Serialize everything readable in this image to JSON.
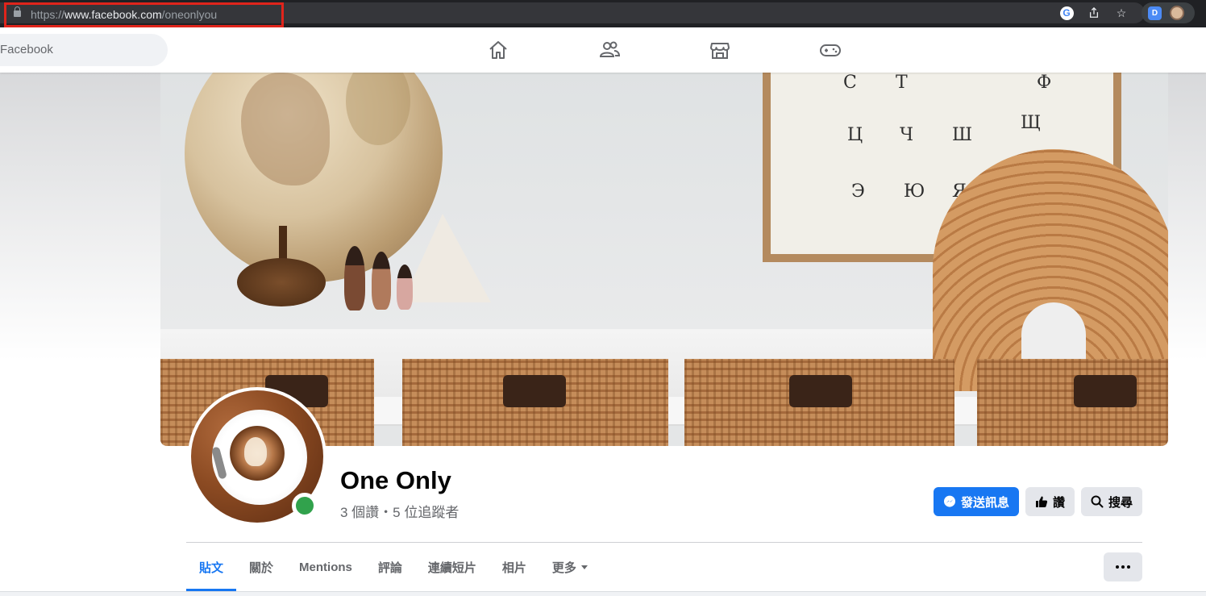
{
  "browser": {
    "url_scheme": "https://",
    "url_host": "www.facebook.com",
    "url_path": "/oneonlyou",
    "icons": [
      "lock-icon",
      "google-icon",
      "share-icon",
      "star-icon",
      "extension-icon",
      "profile-avatar-icon"
    ]
  },
  "fbnav": {
    "search_placeholder": "Facebook",
    "icons": [
      "home-icon",
      "friends-icon",
      "marketplace-icon",
      "gaming-icon"
    ]
  },
  "profile": {
    "name": "One Only",
    "stats": "3 個讚・5 位追蹤者",
    "online_status_color": "#31a24c"
  },
  "actions": {
    "message_label": "發送訊息",
    "like_label": "讚",
    "search_label": "搜尋"
  },
  "tabs": [
    {
      "label": "貼文",
      "active": true
    },
    {
      "label": "關於",
      "active": false
    },
    {
      "label": "Mentions",
      "active": false
    },
    {
      "label": "評論",
      "active": false
    },
    {
      "label": "連續短片",
      "active": false
    },
    {
      "label": "相片",
      "active": false
    },
    {
      "label": "更多",
      "active": false
    }
  ],
  "colors": {
    "accent": "#1877f2",
    "highlight_box": "#e0241b"
  }
}
